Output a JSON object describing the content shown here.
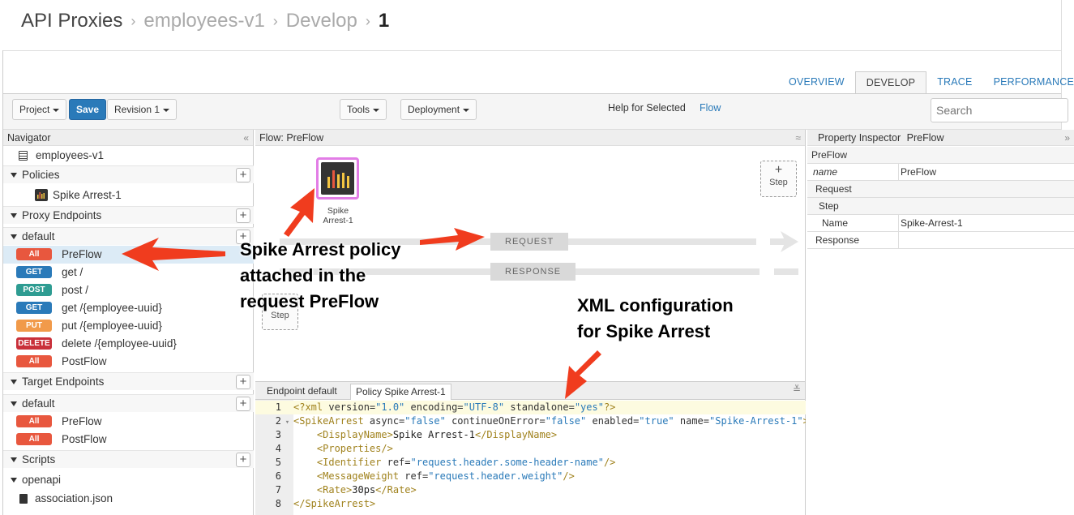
{
  "breadcrumb": {
    "root": "API Proxies",
    "proxy": "employees-v1",
    "section": "Develop",
    "revision": "1"
  },
  "tabs": [
    "OVERVIEW",
    "DEVELOP",
    "TRACE",
    "PERFORMANCE"
  ],
  "toolbar": {
    "project": "Project",
    "save": "Save",
    "revision": "Revision 1",
    "tools": "Tools",
    "deployment": "Deployment",
    "help_text": "Help for Selected",
    "help_link": "Flow",
    "search_placeholder": "Search"
  },
  "navigator": {
    "title": "Navigator",
    "collapse": "«",
    "proxy_name": "employees-v1",
    "policies_label": "Policies",
    "policy": "Spike Arrest-1",
    "proxy_endpoints_label": "Proxy Endpoints",
    "proxy_default": "default",
    "proxy_flows": [
      {
        "badge": "All",
        "label": "PreFlow"
      },
      {
        "badge": "GET",
        "label": "get /"
      },
      {
        "badge": "POST",
        "label": "post /"
      },
      {
        "badge": "GET",
        "label": "get /{employee-uuid}"
      },
      {
        "badge": "PUT",
        "label": "put /{employee-uuid}"
      },
      {
        "badge": "DELETE",
        "label": "delete /{employee-uuid}"
      },
      {
        "badge": "All",
        "label": "PostFlow"
      }
    ],
    "target_endpoints_label": "Target Endpoints",
    "target_default": "default",
    "target_flows": [
      {
        "badge": "All",
        "label": "PreFlow"
      },
      {
        "badge": "All",
        "label": "PostFlow"
      }
    ],
    "scripts_label": "Scripts",
    "scripts_folder": "openapi",
    "scripts_file": "association.json"
  },
  "flow": {
    "title": "Flow: PreFlow",
    "collapse": "≈",
    "policy_label": "Spike Arrest-1",
    "step_plus": "+",
    "step_label": "Step",
    "request_label": "REQUEST",
    "response_label": "RESPONSE"
  },
  "code": {
    "tab_endpoint": "Endpoint default",
    "tab_policy": "Policy Spike Arrest-1",
    "collapse": "≚",
    "lines": [
      {
        "n": "1",
        "fold": "",
        "parts": [
          [
            "tag",
            "<?xml "
          ],
          [
            "attr",
            "version="
          ],
          [
            "val",
            "\"1.0\""
          ],
          [
            "attr",
            " encoding="
          ],
          [
            "val",
            "\"UTF-8\""
          ],
          [
            "attr",
            " standalone="
          ],
          [
            "val",
            "\"yes\""
          ],
          [
            "tag",
            "?>"
          ]
        ]
      },
      {
        "n": "2",
        "fold": "▾",
        "parts": [
          [
            "tag",
            "<SpikeArrest "
          ],
          [
            "attr",
            "async="
          ],
          [
            "val",
            "\"false\""
          ],
          [
            "attr",
            " continueOnError="
          ],
          [
            "val",
            "\"false\""
          ],
          [
            "attr",
            " enabled="
          ],
          [
            "val",
            "\"true\""
          ],
          [
            "attr",
            " name="
          ],
          [
            "val",
            "\"Spike-Arrest-1\""
          ],
          [
            "tag",
            ">"
          ]
        ]
      },
      {
        "n": "3",
        "fold": "",
        "parts": [
          [
            "txt",
            "    "
          ],
          [
            "tag",
            "<DisplayName>"
          ],
          [
            "txt",
            "Spike Arrest-1"
          ],
          [
            "tag",
            "</DisplayName>"
          ]
        ]
      },
      {
        "n": "4",
        "fold": "",
        "parts": [
          [
            "txt",
            "    "
          ],
          [
            "tag",
            "<Properties/>"
          ]
        ]
      },
      {
        "n": "5",
        "fold": "",
        "parts": [
          [
            "txt",
            "    "
          ],
          [
            "tag",
            "<Identifier "
          ],
          [
            "attr",
            "ref="
          ],
          [
            "val",
            "\"request.header.some-header-name\""
          ],
          [
            "tag",
            "/>"
          ]
        ]
      },
      {
        "n": "6",
        "fold": "",
        "parts": [
          [
            "txt",
            "    "
          ],
          [
            "tag",
            "<MessageWeight "
          ],
          [
            "attr",
            "ref="
          ],
          [
            "val",
            "\"request.header.weight\""
          ],
          [
            "tag",
            "/>"
          ]
        ]
      },
      {
        "n": "7",
        "fold": "",
        "parts": [
          [
            "txt",
            "    "
          ],
          [
            "tag",
            "<Rate>"
          ],
          [
            "txt",
            "30ps"
          ],
          [
            "tag",
            "</Rate>"
          ]
        ]
      },
      {
        "n": "8",
        "fold": "",
        "parts": [
          [
            "tag",
            "</SpikeArrest>"
          ]
        ]
      }
    ]
  },
  "inspector": {
    "title": "Property Inspector",
    "context": "PreFlow",
    "collapse": "»",
    "rows": [
      {
        "key": "PreFlow",
        "value": ""
      },
      {
        "key": "name",
        "value": "PreFlow"
      },
      {
        "key": "Request",
        "value": ""
      },
      {
        "key": "Step",
        "value": ""
      },
      {
        "key": "Name",
        "value": "Spike-Arrest-1"
      },
      {
        "key": "Response",
        "value": ""
      }
    ]
  },
  "annotations": {
    "policy_note": [
      "Spike Arrest policy",
      "attached in the",
      "request PreFlow"
    ],
    "xml_note": [
      "XML configuration",
      "for Spike Arrest"
    ]
  },
  "colors": {
    "accent": "#2a7ab9",
    "arrow": "#f03c1e",
    "badge_all": "#e8573e",
    "badge_get": "#2a7ab9",
    "badge_post": "#2e9c92",
    "badge_put": "#f19a4a",
    "badge_delete": "#c9303a",
    "policy_border": "#e27de6"
  }
}
